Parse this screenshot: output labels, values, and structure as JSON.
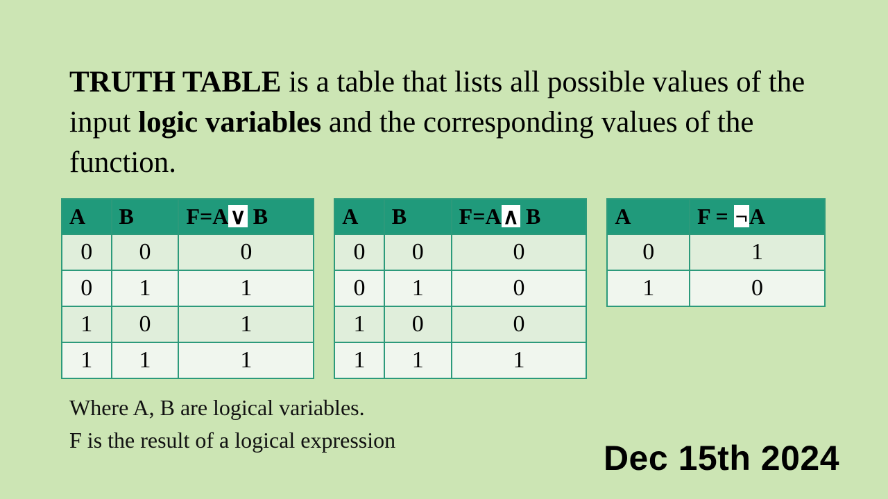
{
  "definition": {
    "lead_bold": "TRUTH TABLE",
    "text1": " is a table that lists all possible values of the input ",
    "mid_bold": "logic variables",
    "text2": " and the corresponding values of the function."
  },
  "tables": {
    "or": {
      "headers": {
        "a": "A",
        "b": "B",
        "f_pre": "F=A",
        "op": "∨",
        "f_post": " B"
      },
      "rows": [
        {
          "a": "0",
          "b": "0",
          "f": "0"
        },
        {
          "a": "0",
          "b": "1",
          "f": "1"
        },
        {
          "a": "1",
          "b": "0",
          "f": "1"
        },
        {
          "a": "1",
          "b": "1",
          "f": "1"
        }
      ]
    },
    "and": {
      "headers": {
        "a": "A",
        "b": "B",
        "f_pre": "F=A",
        "op": "∧",
        "f_post": " B"
      },
      "rows": [
        {
          "a": "0",
          "b": "0",
          "f": "0"
        },
        {
          "a": "0",
          "b": "1",
          "f": "0"
        },
        {
          "a": "1",
          "b": "0",
          "f": "0"
        },
        {
          "a": "1",
          "b": "1",
          "f": "1"
        }
      ]
    },
    "not": {
      "headers": {
        "a": "A",
        "f_pre": "F = ",
        "op": "¬",
        "f_post": "A"
      },
      "rows": [
        {
          "a": "0",
          "f": "1"
        },
        {
          "a": "1",
          "f": "0"
        }
      ]
    }
  },
  "footer": {
    "line1": "Where A, B are logical variables.",
    "line2": "F is the result of a logical expression"
  },
  "date": "Dec 15th 2024"
}
